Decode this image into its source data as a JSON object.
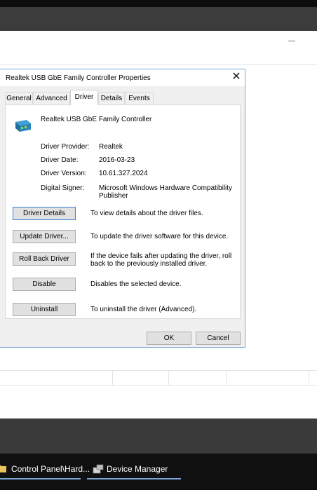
{
  "dialog": {
    "title": "Realtek USB GbE Family Controller Properties",
    "close_glyph": "✕"
  },
  "tabs": [
    {
      "label": "General"
    },
    {
      "label": "Advanced"
    },
    {
      "label": "Driver"
    },
    {
      "label": "Details"
    },
    {
      "label": "Events"
    }
  ],
  "device": {
    "name": "Realtek USB GbE Family Controller",
    "icon": "network-adapter-icon"
  },
  "driver_info": {
    "provider_label": "Driver Provider:",
    "provider_value": "Realtek",
    "date_label": "Driver Date:",
    "date_value": "2016-03-23",
    "version_label": "Driver Version:",
    "version_value": "10.61.327.2024",
    "signer_label": "Digital Signer:",
    "signer_value_line1": "Microsoft Windows Hardware Compatibility",
    "signer_value_line2": "Publisher"
  },
  "actions": {
    "details_label": "Driver Details",
    "details_desc": "To view details about the driver files.",
    "update_label": "Update Driver...",
    "update_desc": "To update the driver software for this device.",
    "rollback_label": "Roll Back Driver",
    "rollback_desc_line1": "If the device fails after updating the driver, roll",
    "rollback_desc_line2": "back to the previously installed driver.",
    "disable_label": "Disable",
    "disable_desc": "Disables the selected device.",
    "uninstall_label": "Uninstall",
    "uninstall_desc": "To uninstall the driver (Advanced)."
  },
  "footer": {
    "ok_label": "OK",
    "cancel_label": "Cancel"
  },
  "taskbar": {
    "items": [
      {
        "label": "Control Panel\\Hard...",
        "icon": "control-panel-icon"
      },
      {
        "label": "Device Manager",
        "icon": "device-manager-icon"
      }
    ]
  },
  "colors": {
    "accent": "#3c7fd1",
    "dialog_border": "#7ba7d4",
    "taskbar": "#101010"
  }
}
